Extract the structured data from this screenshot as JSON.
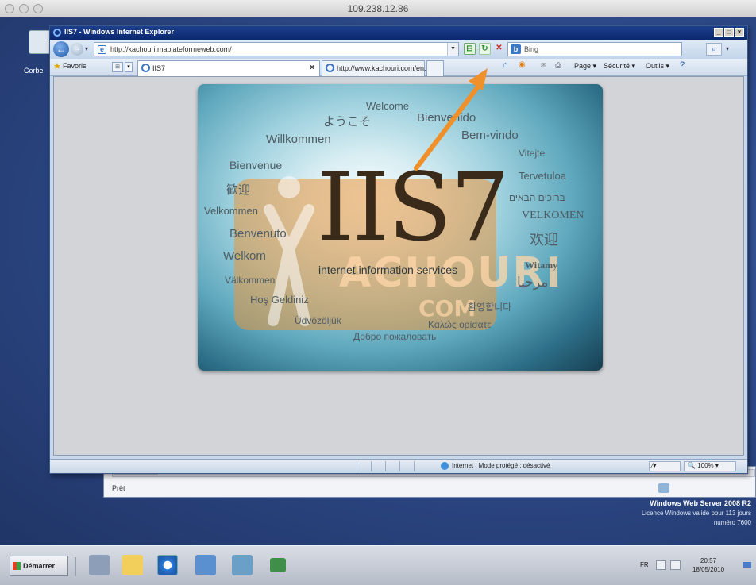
{
  "mac_window": {
    "title": "109.238.12.86"
  },
  "desktop": {
    "icon_label": "Corbe",
    "watermark_line1": "Windows Web Server 2008 R2",
    "watermark_line2": "Licence Windows valide pour 113 jours",
    "watermark_line3": "numéro 7600"
  },
  "background_window": {
    "status": "Prêt"
  },
  "browser": {
    "title": "IIS7 - Windows Internet Explorer",
    "address": "http://kachouri.maplateformeweb.com/",
    "search_placeholder": "Bing",
    "favorites_label": "Favoris",
    "tabs": [
      {
        "label": "IIS7",
        "active": true
      },
      {
        "label": "http://www.kachouri.com/en...",
        "active": false
      }
    ],
    "command_bar": {
      "page": "Page ▾",
      "security": "Sécurité ▾",
      "tools": "Outils ▾"
    },
    "status": {
      "zone": "Internet | Mode protégé : désactivé",
      "zoom": "100%"
    }
  },
  "iis_page": {
    "logo": "IIS7",
    "subtitle": "internet information services",
    "welcome_words": [
      "Welcome",
      "ようこそ",
      "Bienvenido",
      "Willkommen",
      "Bem-vindo",
      "Vitejte",
      "Bienvenue",
      "Tervetuloa",
      "歓迎",
      "ברוכים הבאים",
      "Velkommen",
      "VELKOMEN",
      "Benvenuto",
      "欢迎",
      "Welkom",
      "Witamy",
      "Välkommen",
      "مرحبا",
      "Hoş Geldiniz",
      "환영합니다",
      "Üdvözöljük",
      "Καλώς ορίσατε",
      "Добро пожаловать"
    ],
    "watermark_text": "ACHOURI",
    "watermark_sub": "COM"
  },
  "taskbar": {
    "start_label": "Démarrer",
    "language": "FR",
    "time": "20:57",
    "date": "18/05/2010"
  },
  "colors": {
    "arrow": "#f0902a",
    "title_bar": "#0b2870",
    "desktop": "#2e4a8a"
  }
}
